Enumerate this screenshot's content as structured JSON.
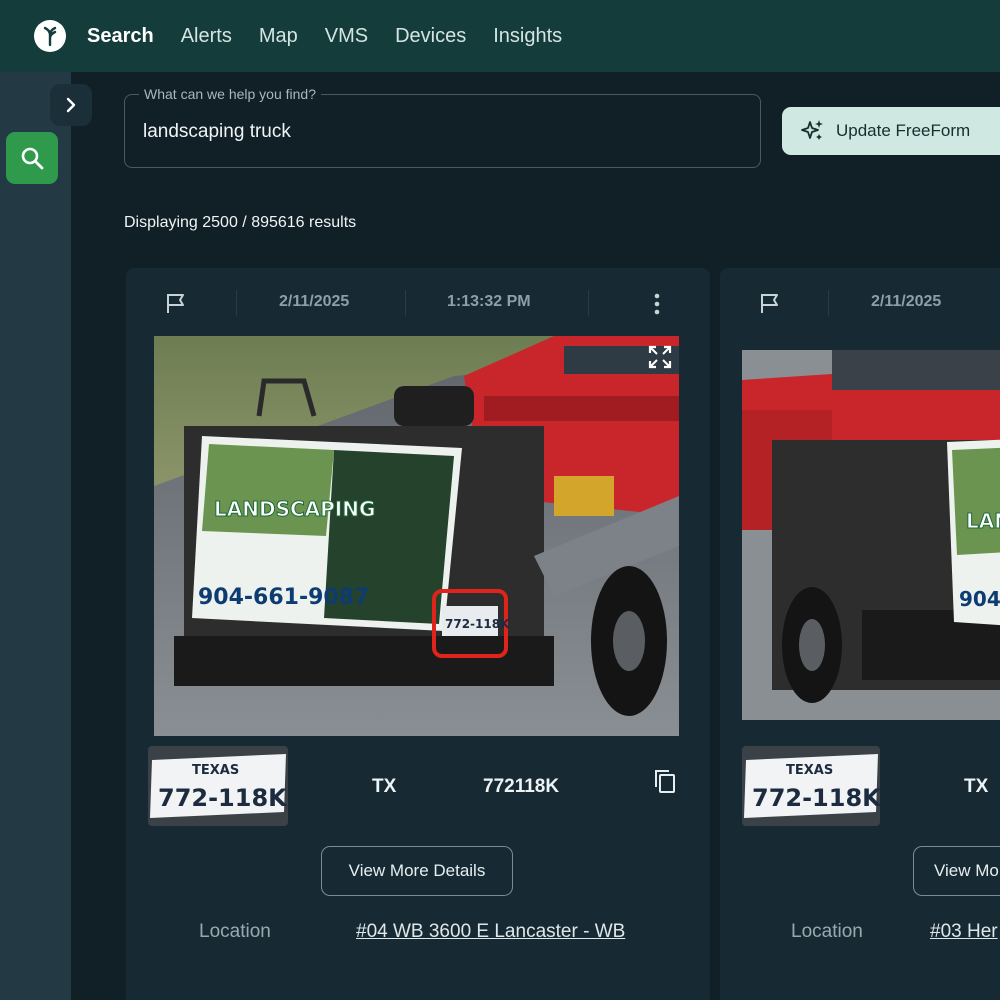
{
  "nav": {
    "items": [
      "Search",
      "Alerts",
      "Map",
      "VMS",
      "Devices",
      "Insights"
    ],
    "active": "Search"
  },
  "search": {
    "legend": "What can we help you find?",
    "value": "landscaping truck"
  },
  "update_button": {
    "label": "Update FreeForm"
  },
  "results": {
    "summary": "Displaying 2500 / 895616 results"
  },
  "cards": [
    {
      "date": "2/11/2025",
      "time": "1:13:32 PM",
      "photo": {
        "sign_title": "LANDSCAPING",
        "sign_phone": "904-661-9087",
        "plate_in_photo": "772-118K"
      },
      "plate_thumb": {
        "state_banner": "TEXAS",
        "number": "772-118K"
      },
      "state": "TX",
      "plate": "772118K",
      "details_label": "View More Details",
      "location_label": "Location",
      "location_value": "#04 WB 3600 E Lancaster - WB"
    },
    {
      "date": "2/11/2025",
      "photo": {
        "sign_title": "LAN",
        "sign_phone": "904-"
      },
      "plate_thumb": {
        "state_banner": "TEXAS",
        "number": "772-118K"
      },
      "state": "TX",
      "details_label": "View Mo",
      "location_label": "Location",
      "location_value": "#03 Her"
    }
  ],
  "colors": {
    "topbar": "#143c3a",
    "rail": "#233944",
    "main_bg": "#111f27",
    "card_bg": "#172a34",
    "accent_green": "#2f9a4c",
    "update_btn": "#cfe9e2",
    "highlight_box": "#e0241b"
  }
}
